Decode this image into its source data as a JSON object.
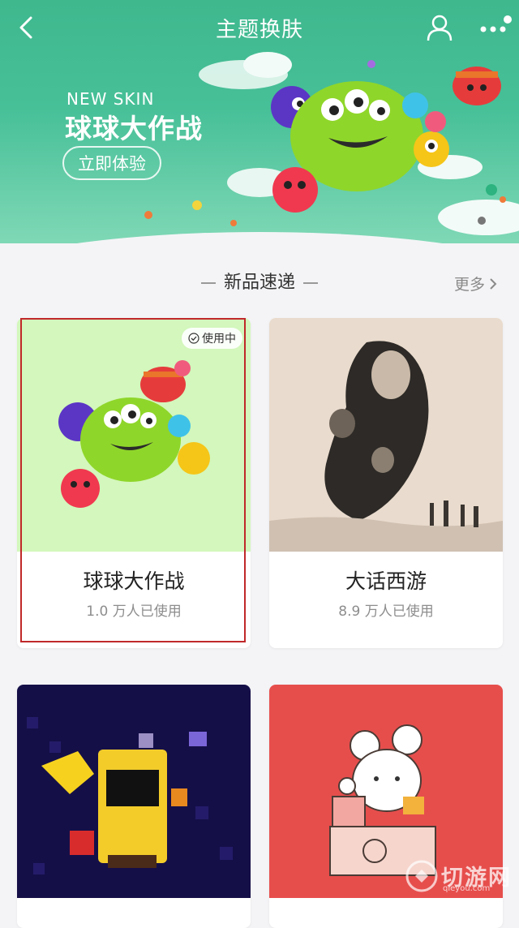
{
  "nav": {
    "title": "主题换肤"
  },
  "banner": {
    "en": "NEW SKIN",
    "title": "球球大作战",
    "cta": "立即体验"
  },
  "section": {
    "title": "新品速递",
    "more": "更多"
  },
  "cards": [
    {
      "name": "球球大作战",
      "count": "1.0 万人已使用",
      "badge": "使用中"
    },
    {
      "name": "大话西游",
      "count": "8.9 万人已使用"
    },
    {
      "name": "",
      "count": ""
    },
    {
      "name": "",
      "count": ""
    }
  ],
  "watermark": {
    "text": "切游网",
    "sub": "qieyou.com"
  },
  "colors": {
    "header": "#43bc93",
    "selected_border": "#c0282a",
    "card1_bg": "#d3f7bc",
    "card2_bg": "#e9dbcd",
    "card3_bg": "#150f48",
    "card4_bg": "#e64e4c"
  }
}
